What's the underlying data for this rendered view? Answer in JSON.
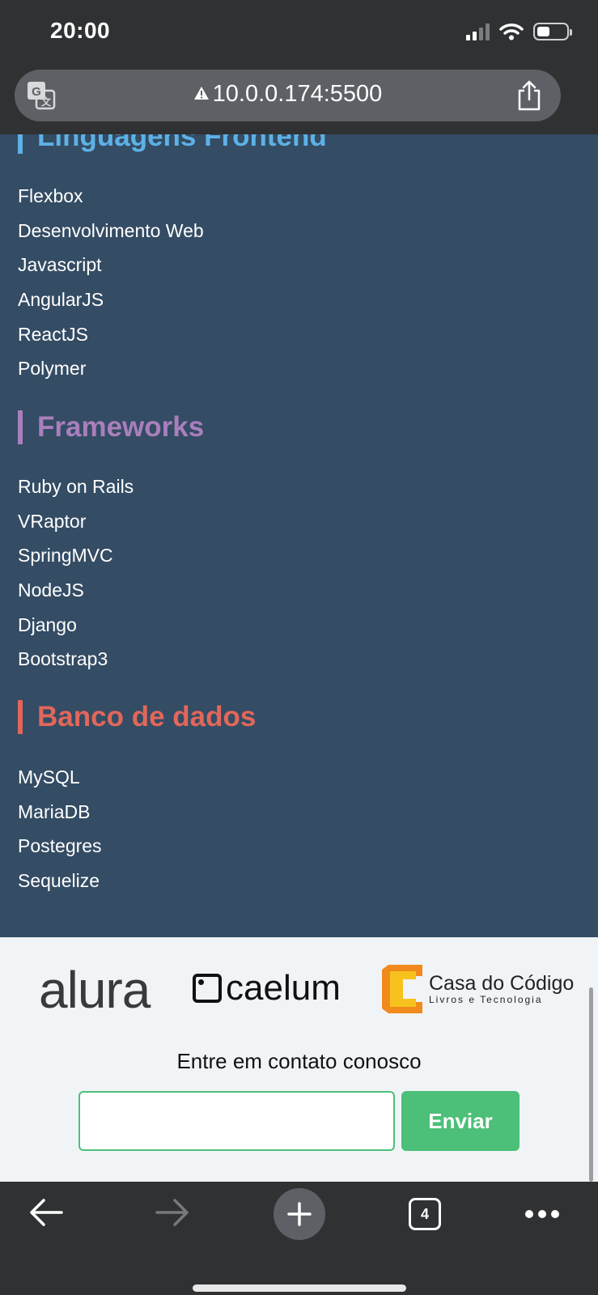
{
  "status_bar": {
    "time": "20:00"
  },
  "url_bar": {
    "url": "10.0.0.174:5500"
  },
  "sections": {
    "frontend": {
      "title": "Linguagens Frontend",
      "items": [
        "Flexbox",
        "Desenvolvimento Web",
        "Javascript",
        "AngularJS",
        "ReactJS",
        "Polymer"
      ]
    },
    "frameworks": {
      "title": "Frameworks",
      "items": [
        "Ruby on Rails",
        "VRaptor",
        "SpringMVC",
        "NodeJS",
        "Django",
        "Bootstrap3"
      ]
    },
    "databases": {
      "title": "Banco de dados",
      "items": [
        "MySQL",
        "MariaDB",
        "Postegres",
        "Sequelize"
      ]
    }
  },
  "footer": {
    "logos": {
      "alura": "alura",
      "caelum": "caelum",
      "cdc_title": "Casa do Código",
      "cdc_subtitle": "Livros e Tecnologia"
    },
    "contact_label": "Entre em contato conosco",
    "input_value": "",
    "send_label": "Enviar"
  },
  "toolbar": {
    "tab_count": "4"
  },
  "colors": {
    "frontend_accent": "#5db1e6",
    "frameworks_accent": "#a97fbd",
    "databases_accent": "#e2675a",
    "content_bg": "#344c64",
    "send_button": "#4cbf78"
  },
  "icons": [
    "translate-icon",
    "warning-icon",
    "share-icon",
    "back-arrow-icon",
    "forward-arrow-icon",
    "plus-icon",
    "tabs-icon",
    "more-icon",
    "signal-icon",
    "wifi-icon",
    "battery-icon"
  ]
}
